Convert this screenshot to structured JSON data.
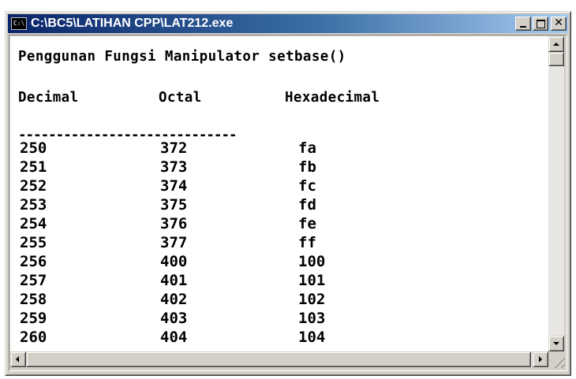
{
  "window": {
    "title": "C:\\BC5\\LATIHAN CPP\\LAT212.exe",
    "icon": "console-app-icon",
    "icon_text": "C:\\",
    "title_color": "#0a246a"
  },
  "console": {
    "heading": "Penggunan Fungsi Manipulator setbase()",
    "columns": [
      "Decimal",
      "Octal",
      "Hexadecimal"
    ],
    "separator": "-----------------------------",
    "rows": [
      [
        "250",
        "372",
        "fa"
      ],
      [
        "251",
        "373",
        "fb"
      ],
      [
        "252",
        "374",
        "fc"
      ],
      [
        "253",
        "375",
        "fd"
      ],
      [
        "254",
        "376",
        "fe"
      ],
      [
        "255",
        "377",
        "ff"
      ],
      [
        "256",
        "400",
        "100"
      ],
      [
        "257",
        "401",
        "101"
      ],
      [
        "258",
        "402",
        "102"
      ],
      [
        "259",
        "403",
        "103"
      ],
      [
        "260",
        "404",
        "104"
      ]
    ]
  },
  "controls": {
    "minimize": "minimize-icon",
    "maximize": "maximize-icon",
    "close": "close-icon",
    "close_glyph": "✕"
  }
}
